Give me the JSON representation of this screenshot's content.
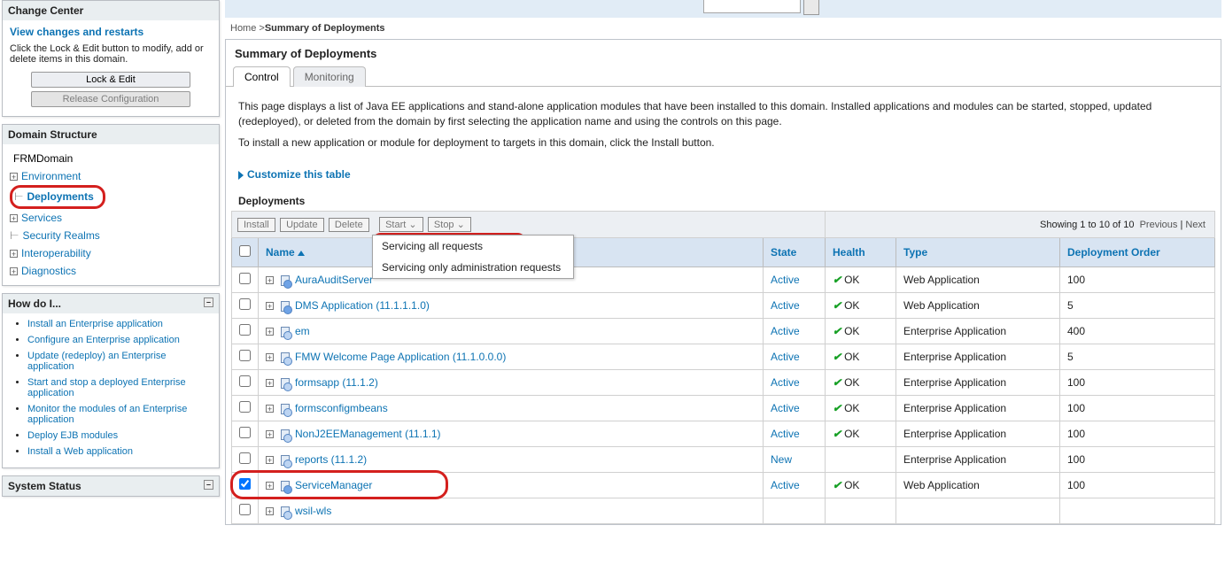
{
  "change_center": {
    "title": "Change Center",
    "view_link": "View changes and restarts",
    "desc": "Click the Lock & Edit button to modify, add or delete items in this domain.",
    "lock_btn": "Lock & Edit",
    "release_btn": "Release Configuration"
  },
  "domain_structure": {
    "title": "Domain Structure",
    "root": "FRMDomain",
    "items": [
      {
        "label": "Environment",
        "expand": "+"
      },
      {
        "label": "Deployments",
        "expand": "",
        "highlight": true
      },
      {
        "label": "Services",
        "expand": "+"
      },
      {
        "label": "Security Realms",
        "expand": ""
      },
      {
        "label": "Interoperability",
        "expand": "+"
      },
      {
        "label": "Diagnostics",
        "expand": "+"
      }
    ]
  },
  "how_do_i": {
    "title": "How do I...",
    "items": [
      "Install an Enterprise application",
      "Configure an Enterprise application",
      "Update (redeploy) an Enterprise application",
      "Start and stop a deployed Enterprise application",
      "Monitor the modules of an Enterprise application",
      "Deploy EJB modules",
      "Install a Web application"
    ]
  },
  "system_status": {
    "title": "System Status"
  },
  "breadcrumb": {
    "home": "Home",
    "sep": ">",
    "current": "Summary of Deployments"
  },
  "page": {
    "title": "Summary of Deployments",
    "tabs": [
      "Control",
      "Monitoring"
    ],
    "active_tab": "Control",
    "desc1": "This page displays a list of Java EE applications and stand-alone application modules that have been installed to this domain. Installed applications and modules can be started, stopped, updated (redeployed), or deleted from the domain by first selecting the application name and using the controls on this page.",
    "desc2": "To install a new application or module for deployment to targets in this domain, click the Install button.",
    "customize": "Customize this table",
    "table_title": "Deployments",
    "toolbar": {
      "install": "Install",
      "update": "Update",
      "delete": "Delete",
      "start": "Start ⌄",
      "stop": "Stop ⌄"
    },
    "start_menu": [
      "Servicing all requests",
      "Servicing only administration requests"
    ],
    "paging": {
      "summary": "Showing 1 to 10 of 10",
      "prev": "Previous",
      "next": "Next"
    },
    "columns": {
      "name": "Name",
      "state": "State",
      "health": "Health",
      "type": "Type",
      "order": "Deployment Order"
    },
    "ok_text": "OK",
    "rows": [
      {
        "checked": false,
        "name": "AuraAuditServer",
        "state": "Active",
        "health": "OK",
        "type": "Web Application",
        "order": "100",
        "ico": "war"
      },
      {
        "checked": false,
        "name": "DMS Application (11.1.1.1.0)",
        "state": "Active",
        "health": "OK",
        "type": "Web Application",
        "order": "5",
        "ico": "war"
      },
      {
        "checked": false,
        "name": "em",
        "state": "Active",
        "health": "OK",
        "type": "Enterprise Application",
        "order": "400",
        "ico": "ear"
      },
      {
        "checked": false,
        "name": "FMW Welcome Page Application (11.1.0.0.0)",
        "state": "Active",
        "health": "OK",
        "type": "Enterprise Application",
        "order": "5",
        "ico": "ear"
      },
      {
        "checked": false,
        "name": "formsapp (11.1.2)",
        "state": "Active",
        "health": "OK",
        "type": "Enterprise Application",
        "order": "100",
        "ico": "ear"
      },
      {
        "checked": false,
        "name": "formsconfigmbeans",
        "state": "Active",
        "health": "OK",
        "type": "Enterprise Application",
        "order": "100",
        "ico": "ear"
      },
      {
        "checked": false,
        "name": "NonJ2EEManagement (11.1.1)",
        "state": "Active",
        "health": "OK",
        "type": "Enterprise Application",
        "order": "100",
        "ico": "ear"
      },
      {
        "checked": false,
        "name": "reports (11.1.2)",
        "state": "New",
        "health": "",
        "type": "Enterprise Application",
        "order": "100",
        "ico": "ear"
      },
      {
        "checked": true,
        "name": "ServiceManager",
        "state": "Active",
        "health": "OK",
        "type": "Web Application",
        "order": "100",
        "ico": "war",
        "row_highlight": true
      },
      {
        "checked": false,
        "name": "wsil-wls",
        "state": "",
        "health": "",
        "type": "",
        "order": "",
        "ico": "ear"
      }
    ]
  }
}
